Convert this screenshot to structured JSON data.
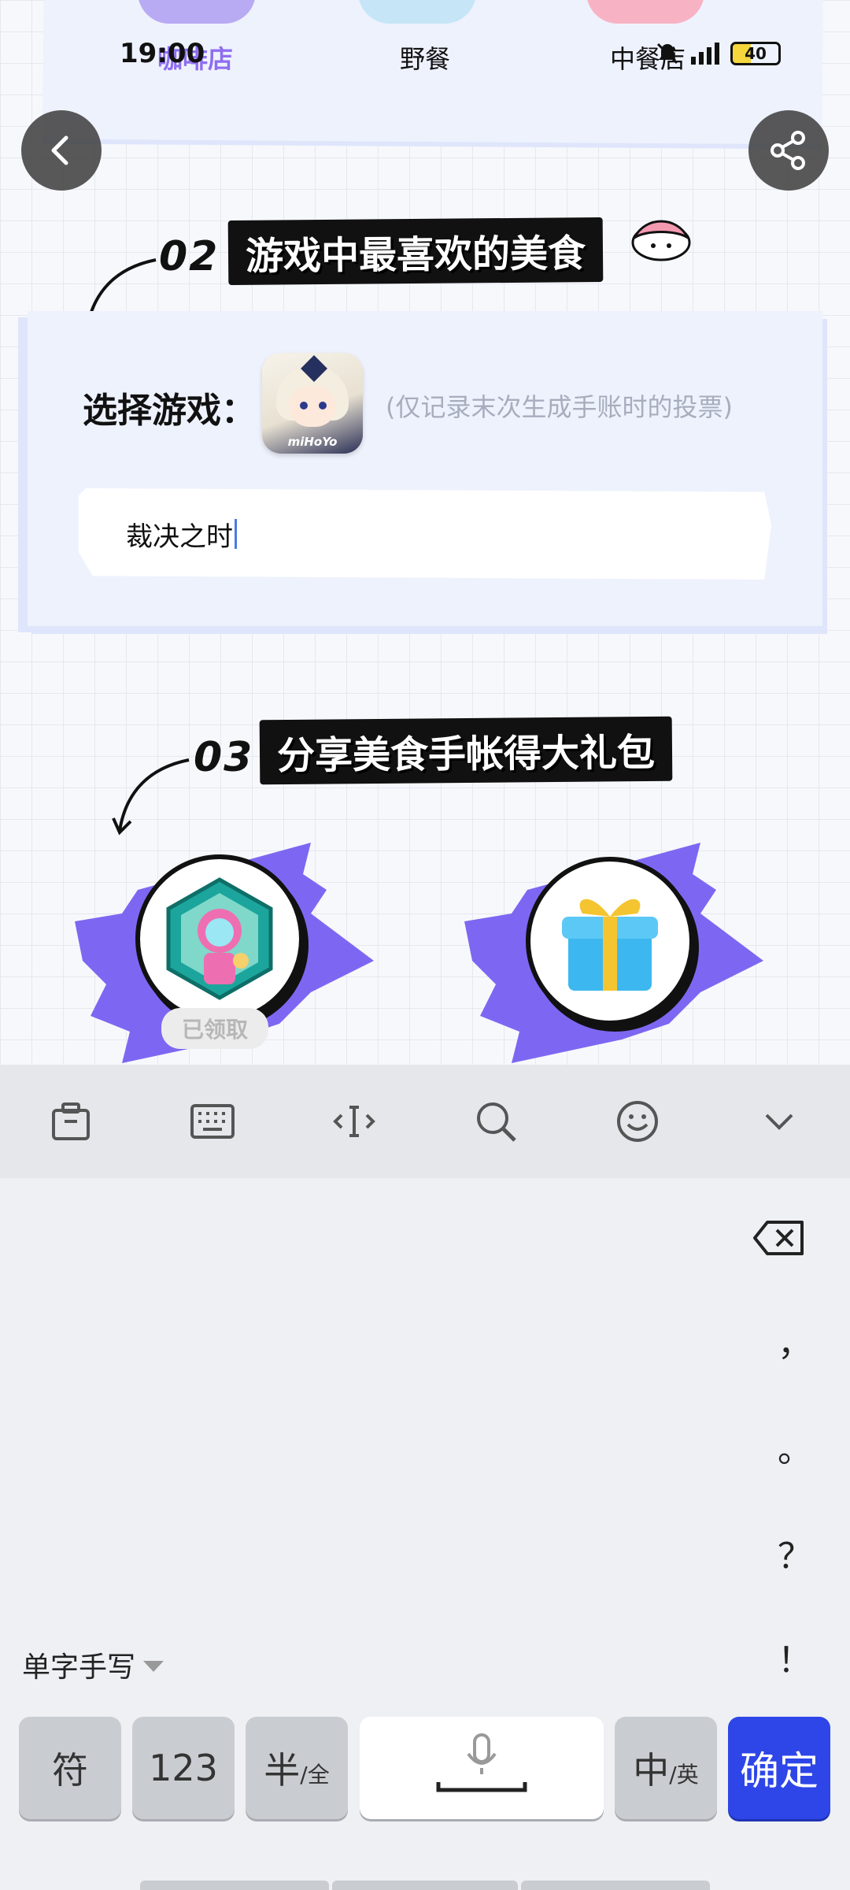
{
  "status_bar": {
    "time": "19:00",
    "battery": "40"
  },
  "prev_section": {
    "categories": [
      "咖啡店",
      "野餐",
      "中餐店"
    ]
  },
  "section2": {
    "number": "02",
    "title": "游戏中最喜欢的美食",
    "select_label": "选择游戏：",
    "game_icon_brand": "miHoYo",
    "note": "(仅记录末次生成手账时的投票)",
    "input_value": "裁决之时"
  },
  "section3": {
    "number": "03",
    "title": "分享美食手帐得大礼包",
    "claimed_label": "已领取"
  },
  "keyboard": {
    "punctuation": [
      "，",
      "。",
      "？",
      "！"
    ],
    "handwriting_mode": "单字手写",
    "keys": {
      "symbol": "符",
      "number": "123",
      "half": "半",
      "half_sub": "/全",
      "chinese": "中",
      "chinese_sub": "/英",
      "confirm": "确定"
    }
  },
  "colors": {
    "accent": "#2e46e8",
    "burst": "#7d67f2",
    "card": "#eef2fd"
  }
}
